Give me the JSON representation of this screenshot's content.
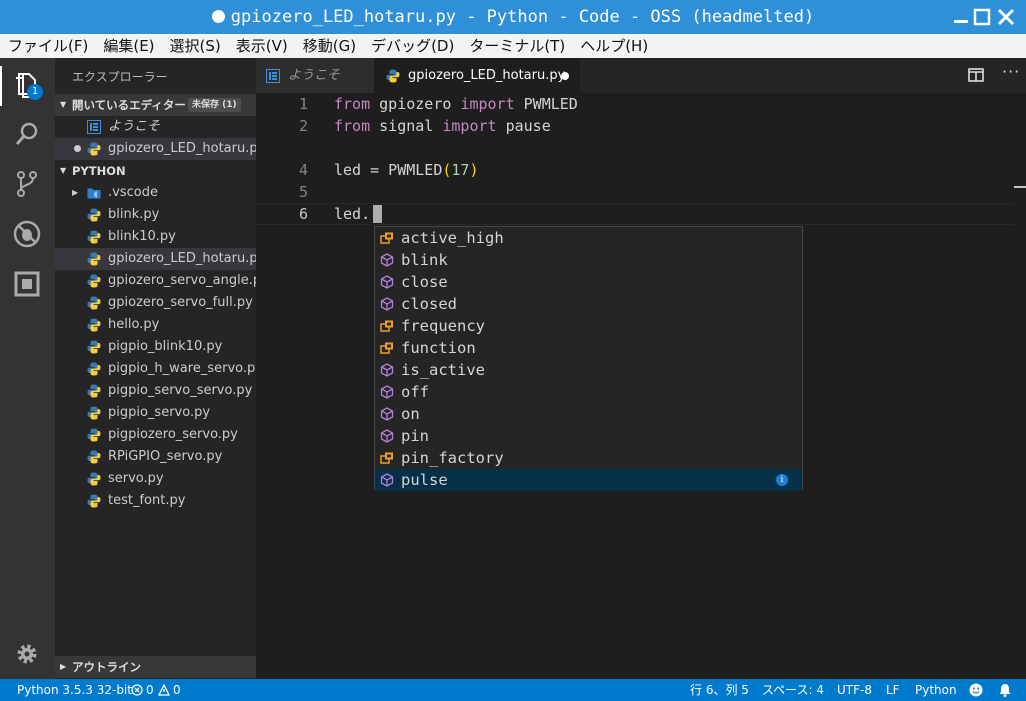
{
  "titlebar": {
    "title": "gpiozero_LED_hotaru.py - Python - Code - OSS (headmelted)"
  },
  "menu": [
    "ファイル(F)",
    "編集(E)",
    "選択(S)",
    "表示(V)",
    "移動(G)",
    "デバッグ(D)",
    "ターミナル(T)",
    "ヘルプ(H)"
  ],
  "activity": {
    "badge": "1"
  },
  "sidebar": {
    "title": "エクスプローラー",
    "open_editors": {
      "label": "開いているエディター",
      "unsaved": "未保存 (1)",
      "items": [
        "ようこそ",
        "gpiozero_LED_hotaru.py"
      ]
    },
    "folder": {
      "label": "PYTHON",
      "vscode": ".vscode",
      "files": [
        "blink.py",
        "blink10.py",
        "gpiozero_LED_hotaru.py",
        "gpiozero_servo_angle.py",
        "gpiozero_servo_full.py",
        "hello.py",
        "pigpio_blink10.py",
        "pigpio_h_ware_servo.py",
        "pigpio_servo_servo.py",
        "pigpio_servo.py",
        "pigpiozero_servo.py",
        "RPiGPIO_servo.py",
        "servo.py",
        "test_font.py"
      ]
    },
    "outline": "アウトライン"
  },
  "tabs": [
    "ようこそ",
    "gpiozero_LED_hotaru.py"
  ],
  "editor": {
    "line_numbers": [
      "1",
      "2",
      "4",
      "5",
      "6"
    ],
    "line1": {
      "kw1": "from",
      "mod": " gpiozero ",
      "kw2": "import",
      "name": " PWMLED"
    },
    "line2": {
      "kw1": "from",
      "mod": " signal ",
      "kw2": "import",
      "name": " pause"
    },
    "line4": {
      "a": "led = PWMLED",
      "open": "(",
      "num": "17",
      "close": ")"
    },
    "line6": {
      "text": "led."
    }
  },
  "suggestions": [
    {
      "label": "active_high",
      "kind": "property-icon"
    },
    {
      "label": "blink",
      "kind": "method-icon"
    },
    {
      "label": "close",
      "kind": "method-icon"
    },
    {
      "label": "closed",
      "kind": "method-icon"
    },
    {
      "label": "frequency",
      "kind": "property-icon"
    },
    {
      "label": "function",
      "kind": "property-icon"
    },
    {
      "label": "is_active",
      "kind": "method-icon"
    },
    {
      "label": "off",
      "kind": "method-icon"
    },
    {
      "label": "on",
      "kind": "method-icon"
    },
    {
      "label": "pin",
      "kind": "method-icon"
    },
    {
      "label": "pin_factory",
      "kind": "property-icon"
    },
    {
      "label": "pulse",
      "kind": "method-icon"
    }
  ],
  "statusbar": {
    "interpreter": "Python 3.5.3 32-bit",
    "errors": "0",
    "warnings": "0",
    "position": "行 6、列 5",
    "spaces": "スペース: 4",
    "encoding": "UTF-8",
    "eol": "LF",
    "language": "Python"
  },
  "colors": {
    "accent": "#007acc",
    "title": "#2f8fd8",
    "keyword": "#c586c0"
  }
}
